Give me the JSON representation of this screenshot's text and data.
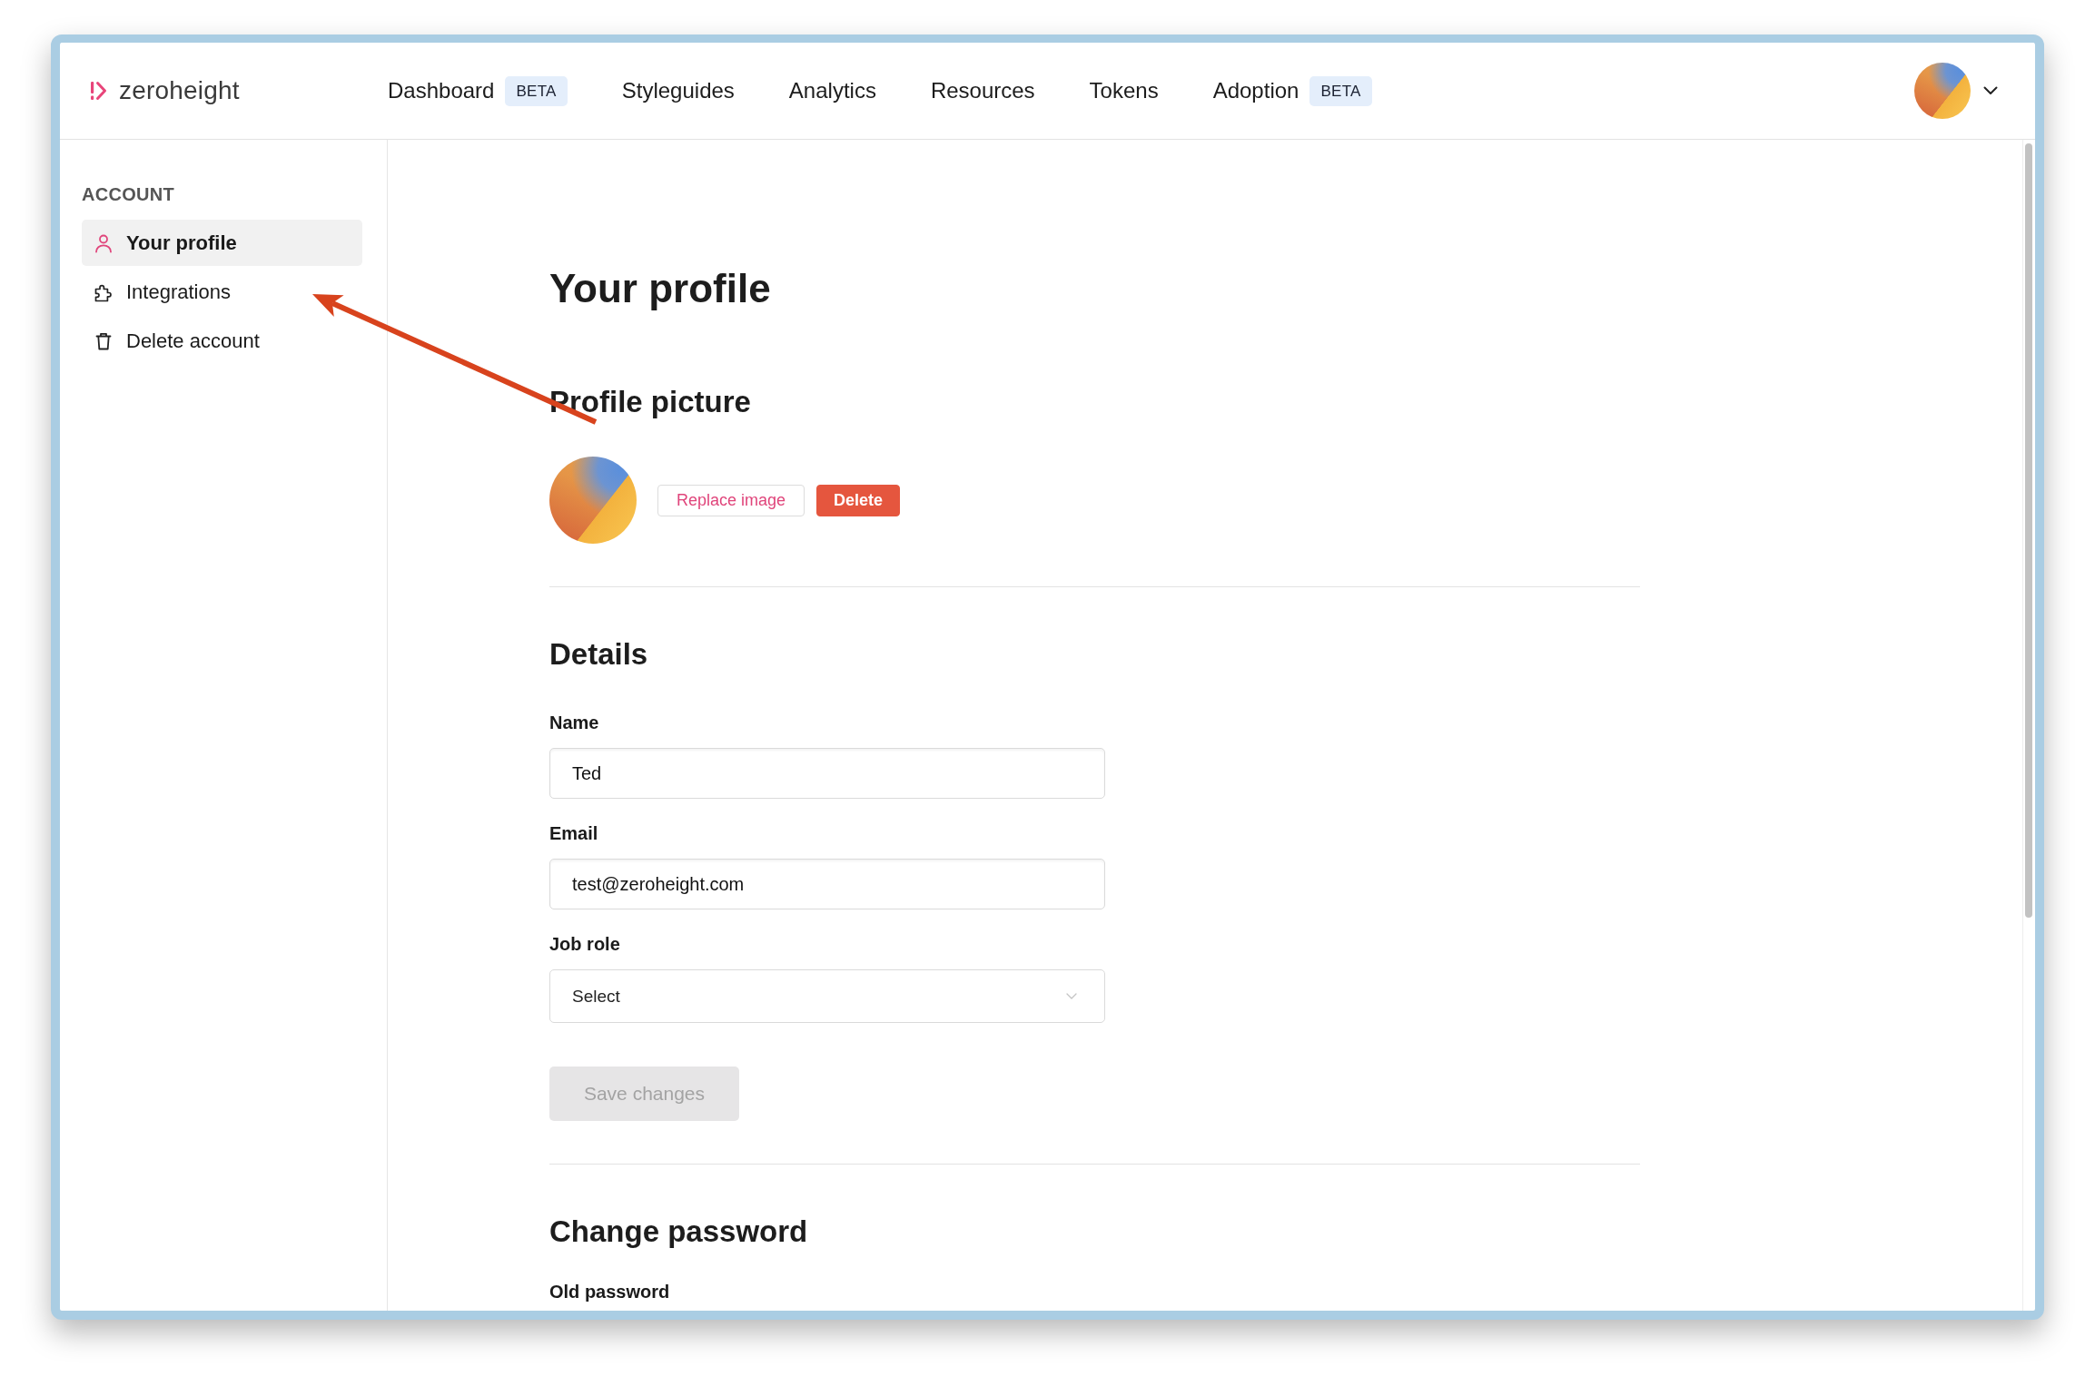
{
  "header": {
    "logo": {
      "text": "zeroheight"
    },
    "nav": [
      {
        "label": "Dashboard",
        "badge": "BETA",
        "selected": false
      },
      {
        "label": "Styleguides",
        "selected": false
      },
      {
        "label": "Analytics",
        "selected": false
      },
      {
        "label": "Resources",
        "selected": false
      },
      {
        "label": "Tokens",
        "selected": false
      },
      {
        "label": "Adoption",
        "badge": "BETA",
        "selected": false
      }
    ]
  },
  "sidebar": {
    "heading": "ACCOUNT",
    "items": [
      {
        "label": "Your profile",
        "selected": true
      },
      {
        "label": "Integrations",
        "selected": false
      },
      {
        "label": "Delete account",
        "selected": false
      }
    ]
  },
  "main": {
    "title": "Your profile",
    "profile_picture": {
      "heading": "Profile picture",
      "buttons": [
        {
          "label": "Replace image",
          "kind": "secondary"
        },
        {
          "label": "Delete",
          "kind": "danger"
        }
      ]
    },
    "details": {
      "heading": "Details",
      "fields": [
        {
          "label": "Name",
          "kind": "text",
          "value": "Ted"
        },
        {
          "label": "Email",
          "kind": "text",
          "value": "test@zeroheight.com"
        },
        {
          "label": "Job role",
          "kind": "select",
          "placeholder": "Select"
        }
      ],
      "save_button": {
        "label": "Save changes",
        "disabled": true
      }
    },
    "change_password": {
      "heading": "Change password",
      "fields": [
        {
          "label": "Old password"
        }
      ]
    }
  },
  "annotations": [
    {
      "kind": "arrow"
    }
  ]
}
